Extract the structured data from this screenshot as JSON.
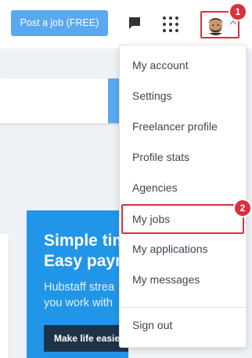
{
  "header": {
    "post_job_label": "Post a job (FREE)",
    "messages_icon": "chat-bubble-icon",
    "apps_icon": "grid-dots-icon",
    "profile_icon": "user-avatar",
    "chevron_icon": "chevron-up-icon"
  },
  "annotations": {
    "step_1": "1",
    "step_2": "2",
    "highlight_color": "#d9303e"
  },
  "promo": {
    "title_line1": "Simple tim",
    "title_line2": "Easy paym",
    "text_line1": "Hubstaff strea",
    "text_line2": "you work with",
    "button_label": "Make life easie",
    "background_color": "#2196e8"
  },
  "account_menu": {
    "items": [
      {
        "label": "My account"
      },
      {
        "label": "Settings"
      },
      {
        "label": "Freelancer profile"
      },
      {
        "label": "Profile stats"
      },
      {
        "label": "Agencies"
      },
      {
        "label": "My jobs"
      },
      {
        "label": "My applications"
      },
      {
        "label": "My messages"
      }
    ],
    "sign_out_label": "Sign out"
  },
  "colors": {
    "accent": "#5aa9f0",
    "page_background": "#eef1f5"
  }
}
